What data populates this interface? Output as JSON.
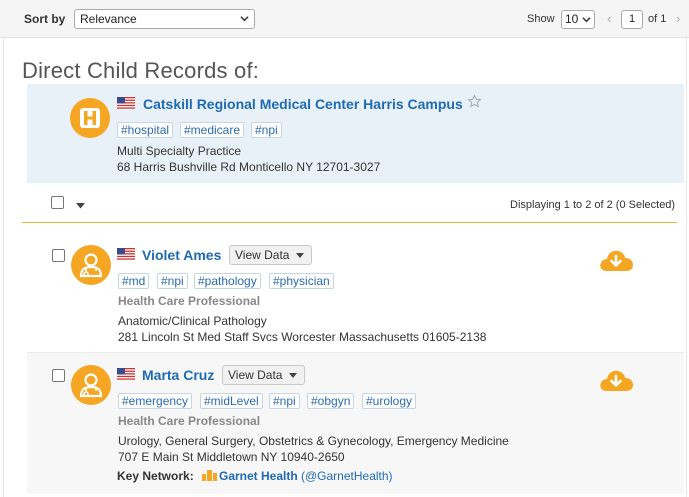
{
  "toolbar": {
    "sort_label": "Sort by",
    "sort_value": "Relevance",
    "show_label": "Show",
    "show_value": "10",
    "page_value": "1",
    "of_label": "of 1",
    "prev_icon": "chevron-left-icon",
    "next_icon": "chevron-right-icon"
  },
  "heading": "Direct Child Records of:",
  "parent": {
    "name": "Catskill Regional Medical Center Harris Campus",
    "icon": "hospital-icon",
    "tags": [
      "#hospital",
      "#medicare",
      "#npi"
    ],
    "type": "Multi Specialty Practice",
    "address": "68 Harris Bushville Rd Monticello NY 12701-3027"
  },
  "list": {
    "display_count": "Displaying 1 to 2 of 2 (0 Selected)"
  },
  "records": [
    {
      "name": "Violet Ames",
      "view_label": "View Data",
      "tags": [
        "#md",
        "#npi",
        "#pathology",
        "#physician"
      ],
      "category": "Health Care Professional",
      "specialty": "Anatomic/Clinical Pathology",
      "address": "281 Lincoln St Med Staff Svcs Worcester Massachusetts 01605-2138"
    },
    {
      "name": "Marta Cruz",
      "view_label": "View Data",
      "tags": [
        "#emergency",
        "#midLevel",
        "#npi",
        "#obgyn",
        "#urology"
      ],
      "category": "Health Care Professional",
      "specialty": "Urology, General Surgery, Obstetrics & Gynecology, Emergency Medicine",
      "address": "707 E Main St Middletown NY 10940-2650",
      "key_network_label": "Key Network:",
      "key_network_name": "Garnet Health",
      "key_network_handle": "(@GarnetHealth)"
    }
  ],
  "colors": {
    "accent_orange": "#f5a623",
    "link_blue": "#1f6ab0",
    "parent_bg": "#e8f1f7",
    "divider_gold": "#e0b23a"
  }
}
